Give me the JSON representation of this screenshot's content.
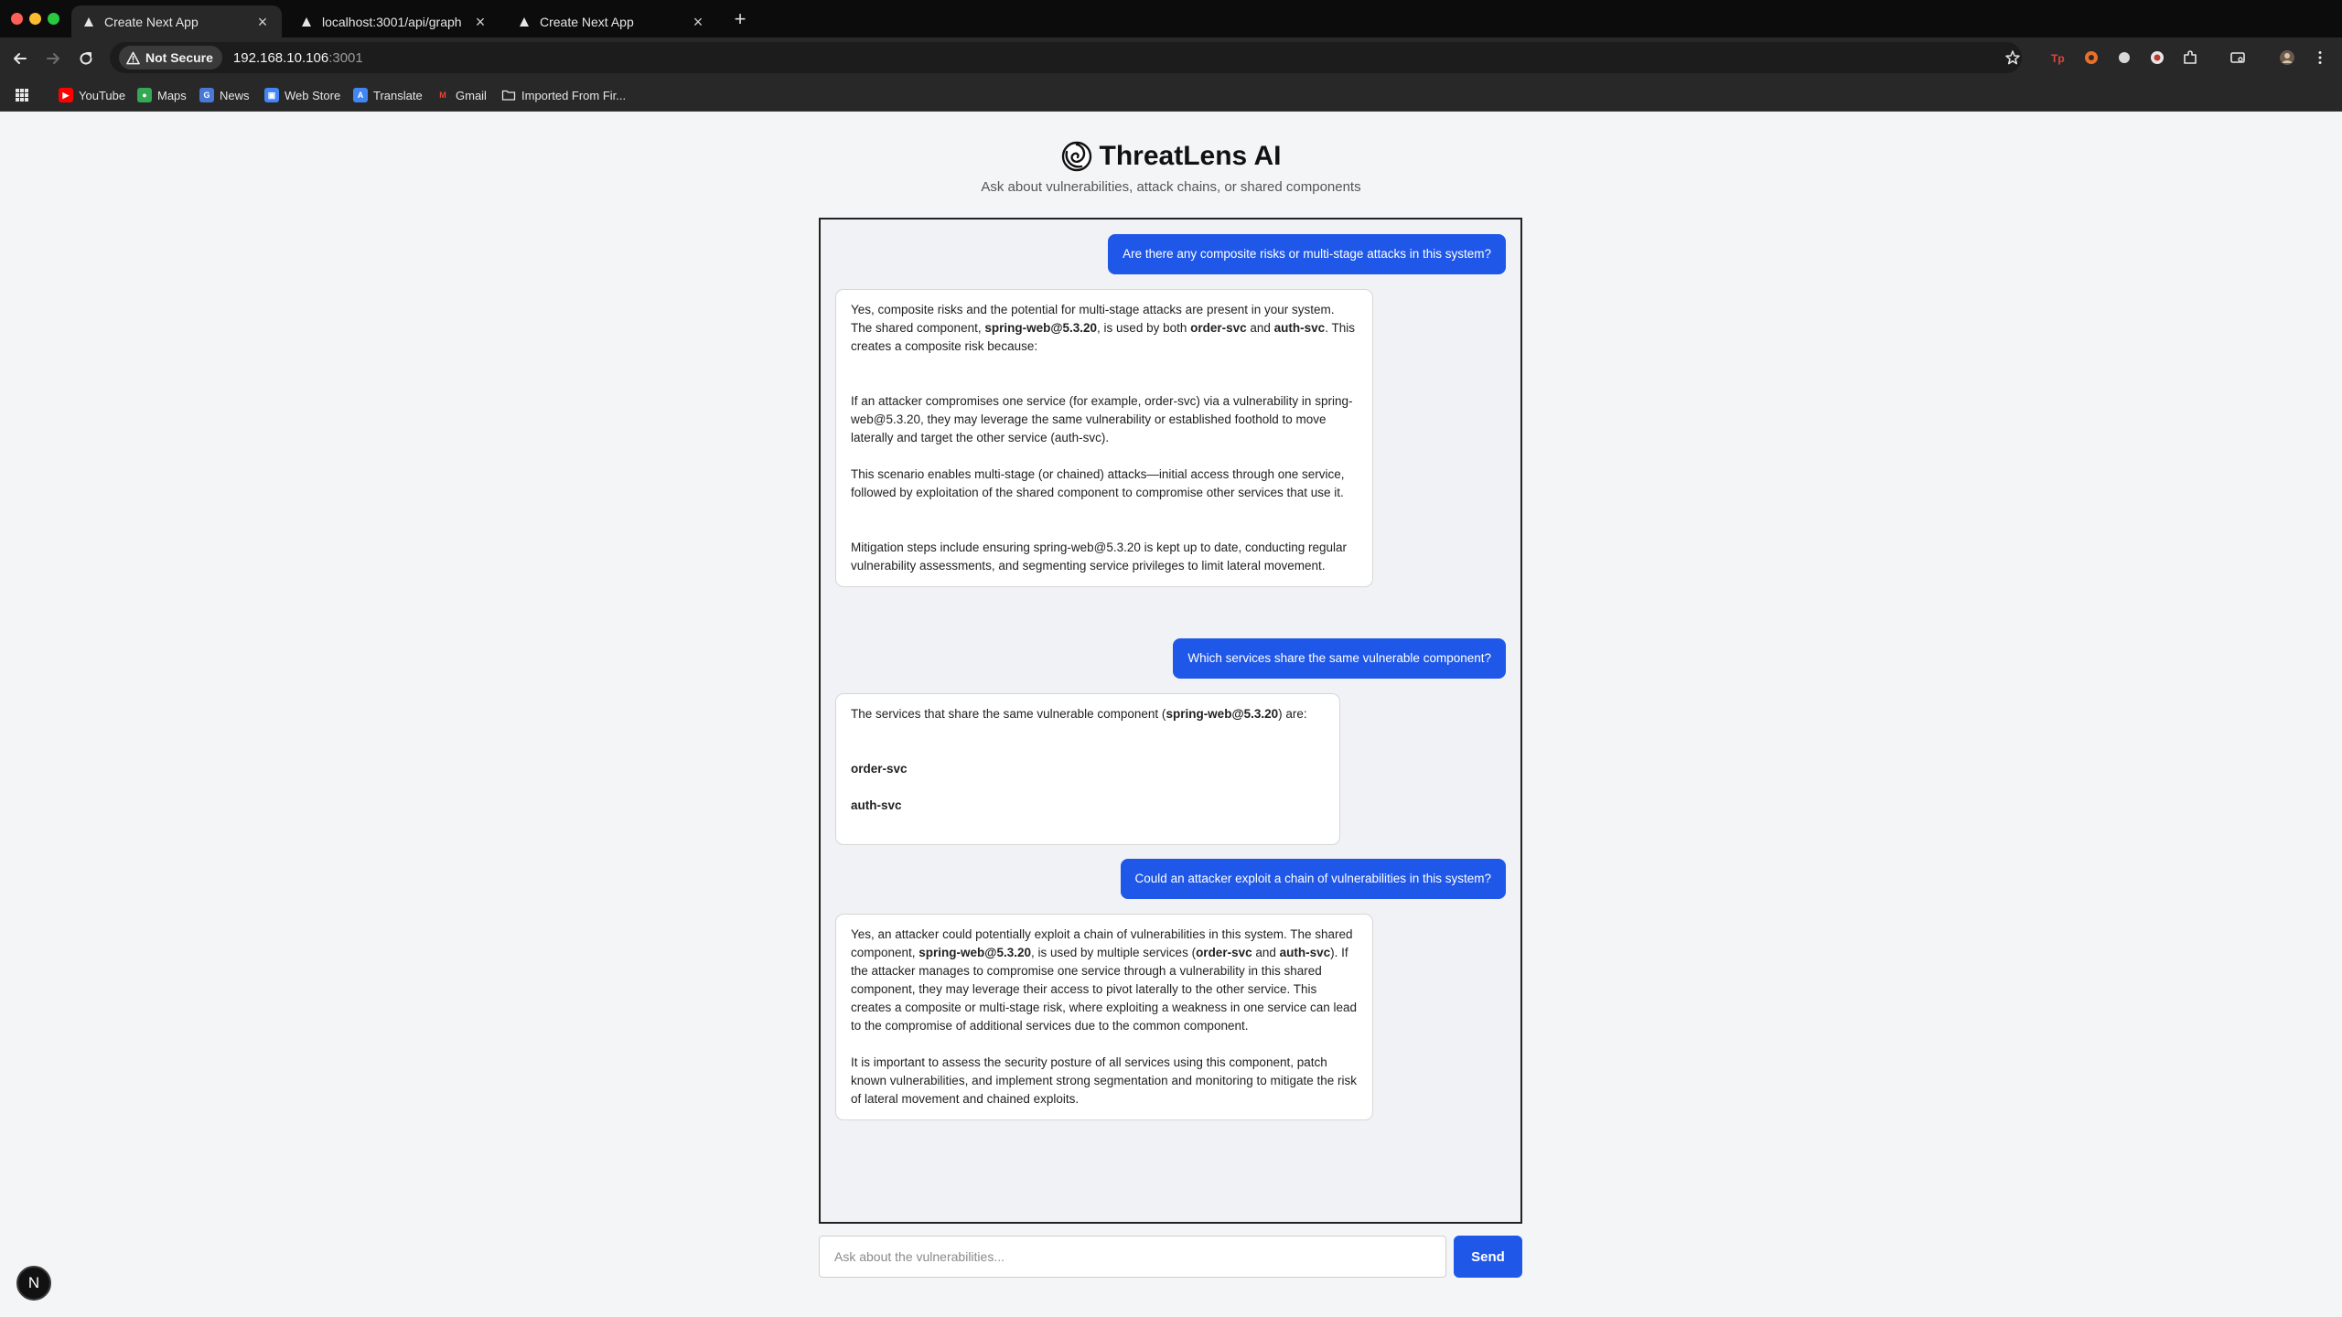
{
  "browser": {
    "tabs": [
      {
        "label": "Create Next App",
        "active": true
      },
      {
        "label": "localhost:3001/api/graph",
        "active": false
      },
      {
        "label": "Create Next App",
        "active": false
      }
    ],
    "security_label": "Not Secure",
    "url_host": "192.168.10.106",
    "url_port": ":3001",
    "bookmarks": [
      "YouTube",
      "Maps",
      "News",
      "Web Store",
      "Translate",
      "Gmail",
      "Imported From Fir..."
    ]
  },
  "app": {
    "title": "ThreatLens AI",
    "subtitle": "Ask about vulnerabilities, attack chains, or shared components"
  },
  "conversation": {
    "q1": "Are there any composite risks or multi-stage attacks in this system?",
    "a1": {
      "p1_a": "Yes, composite risks and the potential for multi-stage attacks are present in your system. The shared component, ",
      "p1_b": "spring-web@5.3.20",
      "p1_c": ", is used by both ",
      "p1_d": "order-svc",
      "p1_e": " and ",
      "p1_f": "auth-svc",
      "p1_g": ". This creates a composite risk because:",
      "p2": "If an attacker compromises one service (for example, order-svc) via a vulnerability in spring-web@5.3.20, they may leverage the same vulnerability or established foothold to move laterally and target the other service (auth-svc).",
      "p3": "This scenario enables multi-stage (or chained) attacks—initial access through one service, followed by exploitation of the shared component to compromise other services that use it.",
      "p4": "Mitigation steps include ensuring spring-web@5.3.20 is kept up to date, conducting regular vulnerability assessments, and segmenting service privileges to limit lateral movement."
    },
    "q2": "Which services share the same vulnerable component?",
    "a2": {
      "intro_a": "The services that share the same vulnerable component (",
      "intro_b": "spring-web@5.3.20",
      "intro_c": ") are:",
      "item1": "order-svc",
      "item2": "auth-svc"
    },
    "q3": "Could an attacker exploit a chain of vulnerabilities in this system?",
    "a3": {
      "p1_a": "Yes, an attacker could potentially exploit a chain of vulnerabilities in this system. The shared component, ",
      "p1_b": "spring-web@5.3.20",
      "p1_c": ", is used by multiple services (",
      "p1_d": "order-svc",
      "p1_e": " and ",
      "p1_f": "auth-svc",
      "p1_g": "). If the attacker manages to compromise one service through a vulnerability in this shared component, they may leverage their access to pivot laterally to the other service. This creates a composite or multi-stage risk, where exploiting a weakness in one service can lead to the compromise of additional services due to the common component.",
      "p2": "It is important to assess the security posture of all services using this component, patch known vulnerabilities, and implement strong segmentation and monitoring to mitigate the risk of lateral movement and chained exploits."
    }
  },
  "composer": {
    "placeholder": "Ask about the vulnerabilities...",
    "value": "",
    "send_label": "Send"
  },
  "badge": {
    "label": "N"
  },
  "colors": {
    "accent": "#1f57e8",
    "page_bg": "#f4f5f7",
    "chat_bg": "#f1f2f6"
  }
}
